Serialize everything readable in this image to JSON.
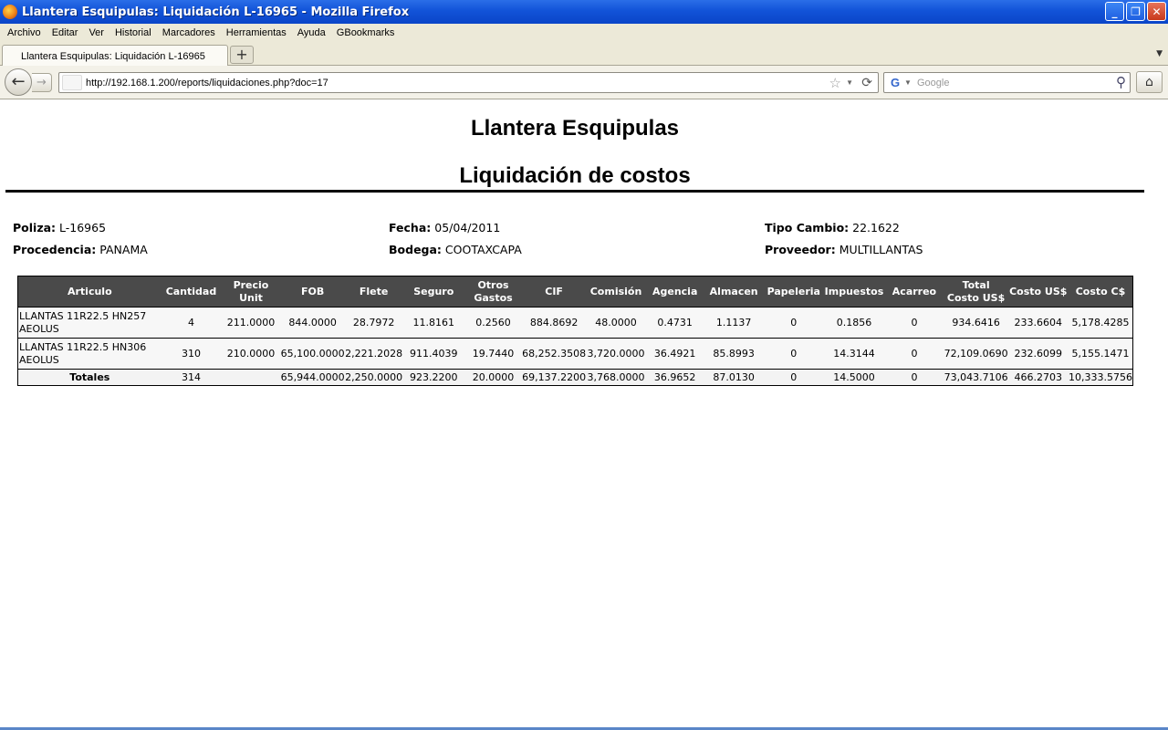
{
  "window": {
    "title": "Llantera Esquipulas: Liquidación L-16965 - Mozilla Firefox",
    "controls": {
      "minimize": "_",
      "maximize": "❐",
      "close": "✕"
    }
  },
  "menu": [
    "Archivo",
    "Editar",
    "Ver",
    "Historial",
    "Marcadores",
    "Herramientas",
    "Ayuda",
    "GBookmarks"
  ],
  "tab": {
    "label": "Llantera Esquipulas: Liquidación L-16965",
    "new_tab": "+"
  },
  "nav": {
    "url": "http://192.168.1.200/reports/liquidaciones.php?doc=17",
    "search_placeholder": "Google"
  },
  "report": {
    "company": "Llantera Esquipulas",
    "title": "Liquidación de costos",
    "info": {
      "poliza_label": "Poliza:",
      "poliza": "L-16965",
      "fecha_label": "Fecha:",
      "fecha": "05/04/2011",
      "tipo_cambio_label": "Tipo Cambio:",
      "tipo_cambio": "22.1622",
      "procedencia_label": "Procedencia:",
      "procedencia": "PANAMA",
      "bodega_label": "Bodega:",
      "bodega": "COOTAXCAPA",
      "proveedor_label": "Proveedor:",
      "proveedor": "MULTILLANTAS"
    },
    "headers": {
      "articulo": "Articulo",
      "cantidad": "Cantidad",
      "precio_unit": "Precio Unit",
      "fob": "FOB",
      "flete": "Flete",
      "seguro": "Seguro",
      "otros_1": "Otros",
      "otros_2": "Gastos",
      "cif": "CIF",
      "comision": "Comisión",
      "agencia": "Agencia",
      "almacen": "Almacen",
      "papeleria": "Papeleria",
      "impuestos": "Impuestos",
      "acarreo": "Acarreo",
      "total_1": "Total",
      "total_2": "Costo US$",
      "costo_us": "Costo US$",
      "costo_c": "Costo C$"
    },
    "rows": [
      {
        "articulo": "LLANTAS 11R22.5 HN257 AEOLUS",
        "cantidad": "4",
        "precio_unit": "211.0000",
        "fob": "844.0000",
        "flete": "28.7972",
        "seguro": "11.8161",
        "otros": "0.2560",
        "cif": "884.8692",
        "comision": "48.0000",
        "agencia": "0.4731",
        "almacen": "1.1137",
        "papeleria": "0",
        "impuestos": "0.1856",
        "acarreo": "0",
        "total": "934.6416",
        "costo_us": "233.6604",
        "costo_c": "5,178.4285"
      },
      {
        "articulo": "LLANTAS 11R22.5 HN306 AEOLUS",
        "cantidad": "310",
        "precio_unit": "210.0000",
        "fob": "65,100.0000",
        "flete": "2,221.2028",
        "seguro": "911.4039",
        "otros": "19.7440",
        "cif": "68,252.3508",
        "comision": "3,720.0000",
        "agencia": "36.4921",
        "almacen": "85.8993",
        "papeleria": "0",
        "impuestos": "14.3144",
        "acarreo": "0",
        "total": "72,109.0690",
        "costo_us": "232.6099",
        "costo_c": "5,155.1471"
      }
    ],
    "totals": {
      "label": "Totales",
      "cantidad": "314",
      "precio_unit": "",
      "fob": "65,944.0000",
      "flete": "2,250.0000",
      "seguro": "923.2200",
      "otros": "20.0000",
      "cif": "69,137.2200",
      "comision": "3,768.0000",
      "agencia": "36.9652",
      "almacen": "87.0130",
      "papeleria": "0",
      "impuestos": "14.5000",
      "acarreo": "0",
      "total": "73,043.7106",
      "costo_us": "466.2703",
      "costo_c": "10,333.5756"
    }
  }
}
